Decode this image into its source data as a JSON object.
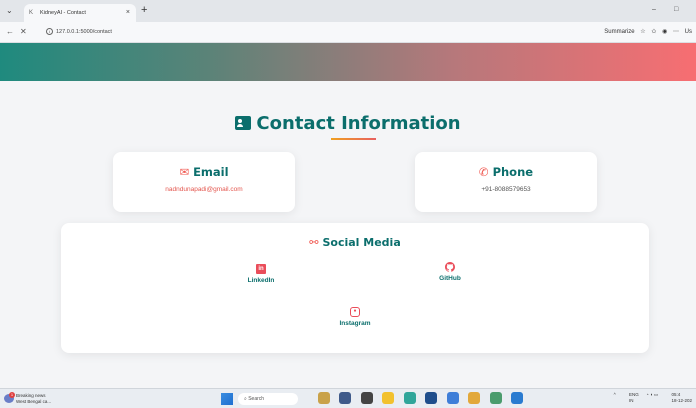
{
  "browser": {
    "tab_favicon": "K",
    "tab_title": "KidneyAI - Contact",
    "tab_close": "×",
    "new_tab": "+",
    "url": "127.0.0.1:5000/contact",
    "summarize_label": "Summarize",
    "window_controls": {
      "minimize": "–",
      "maximize": "□"
    },
    "profile_label": "Us"
  },
  "page": {
    "title": "Contact Information",
    "email": {
      "heading": "Email",
      "value": "nadndunapadi@gmail.com"
    },
    "phone": {
      "heading": "Phone",
      "value": "+91-8088579653"
    },
    "social": {
      "heading": "Social Media",
      "links": [
        {
          "label": "LinkedIn",
          "icon": "in"
        },
        {
          "label": "GitHub",
          "icon": "linkedin-icon"
        },
        {
          "label": "Instagram",
          "icon": "instagram-icon"
        }
      ]
    },
    "colors": {
      "accent": "#0b6e6c",
      "icon": "#f0574f",
      "banner_start": "#1f8a7e",
      "banner_end": "#f76e72"
    }
  },
  "taskbar": {
    "news_title": "Breaking news",
    "news_sub": "West Bengal ca...",
    "news_badge": "1",
    "search_label": "Search",
    "lang": "ENG",
    "region": "IN",
    "time": "05:4",
    "date": "18-12-202"
  }
}
